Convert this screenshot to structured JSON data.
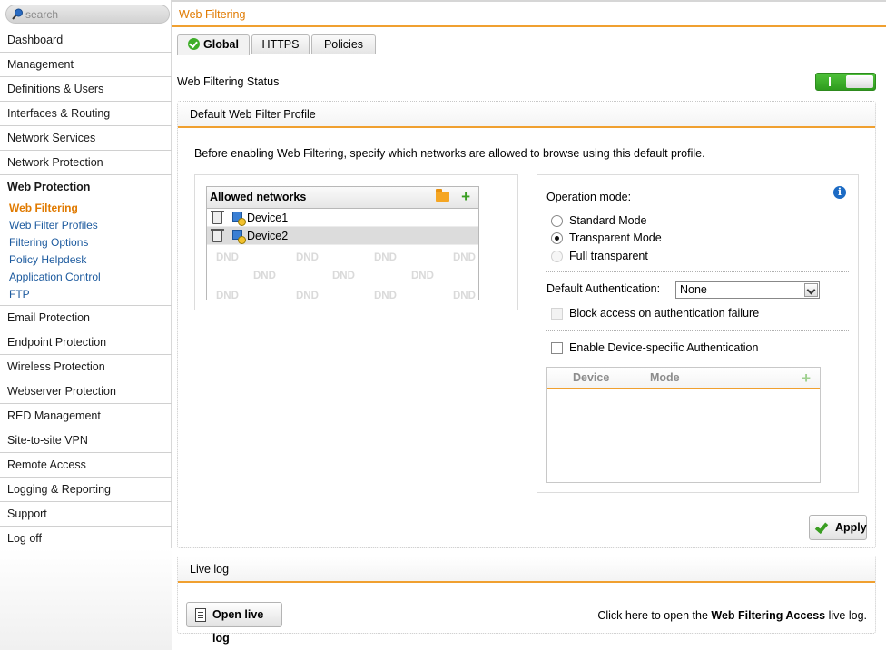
{
  "search": {
    "placeholder": "search"
  },
  "sidebar": {
    "items": [
      {
        "label": "Dashboard"
      },
      {
        "label": "Management"
      },
      {
        "label": "Definitions & Users"
      },
      {
        "label": "Interfaces & Routing"
      },
      {
        "label": "Network Services"
      },
      {
        "label": "Network Protection"
      },
      {
        "label": "Web Protection"
      },
      {
        "label": "Email Protection"
      },
      {
        "label": "Endpoint Protection"
      },
      {
        "label": "Wireless Protection"
      },
      {
        "label": "Webserver Protection"
      },
      {
        "label": "RED Management"
      },
      {
        "label": "Site-to-site VPN"
      },
      {
        "label": "Remote Access"
      },
      {
        "label": "Logging & Reporting"
      },
      {
        "label": "Support"
      },
      {
        "label": "Log off"
      }
    ],
    "subitems": [
      {
        "label": "Web Filtering"
      },
      {
        "label": "Web Filter Profiles"
      },
      {
        "label": "Filtering Options"
      },
      {
        "label": "Policy Helpdesk"
      },
      {
        "label": "Application Control"
      },
      {
        "label": "FTP"
      }
    ]
  },
  "header": {
    "title": "Web Filtering"
  },
  "tabs": [
    {
      "label": "Global"
    },
    {
      "label": "HTTPS"
    },
    {
      "label": "Policies"
    }
  ],
  "status": {
    "label": "Web Filtering Status",
    "enabled": true,
    "on_color": "#3fae2a"
  },
  "profile": {
    "title": "Default Web Filter Profile",
    "description": "Before enabling Web Filtering, specify which networks are allowed to browse using this default profile.",
    "networks": {
      "title": "Allowed networks",
      "rows": [
        {
          "label": "Device1"
        },
        {
          "label": "Device2"
        }
      ],
      "dnd": "DND"
    },
    "operation_mode": {
      "label": "Operation mode:",
      "options": [
        {
          "label": "Standard Mode",
          "checked": false
        },
        {
          "label": "Transparent Mode",
          "checked": true
        },
        {
          "label": "Full transparent",
          "checked": false,
          "disabled": true
        }
      ]
    },
    "auth": {
      "label": "Default Authentication:",
      "value": "None",
      "block_label": "Block access on authentication failure",
      "device_specific_label": "Enable Device-specific Authentication"
    },
    "device_table": {
      "columns": [
        "Device",
        "Mode"
      ]
    },
    "apply_label": "Apply"
  },
  "live_log": {
    "title": "Live log",
    "button_label": "Open live log",
    "desc_prefix": "Click here to open the ",
    "desc_bold": "Web Filtering Access",
    "desc_suffix": " live log."
  },
  "colors": {
    "accent": "#e07a00",
    "link": "#1c5a9e",
    "underline": "#f0a030"
  }
}
